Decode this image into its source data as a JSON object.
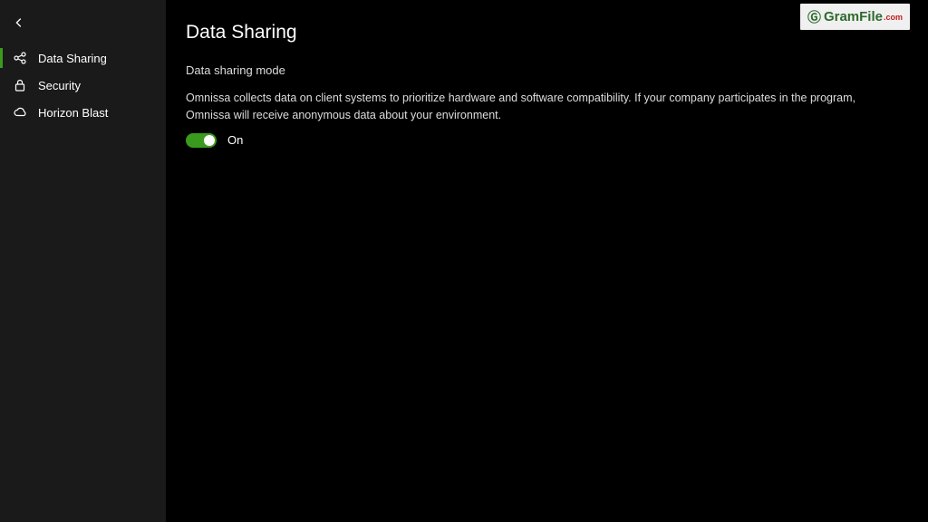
{
  "sidebar": {
    "items": [
      {
        "label": "Data Sharing",
        "icon": "share-icon",
        "active": true
      },
      {
        "label": "Security",
        "icon": "lock-icon",
        "active": false
      },
      {
        "label": "Horizon Blast",
        "icon": "cloud-icon",
        "active": false
      }
    ]
  },
  "main": {
    "title": "Data Sharing",
    "section_label": "Data sharing mode",
    "description": "Omnissa collects data on client systems to prioritize hardware and software compatibility. If your company participates in the program, Omnissa will receive anonymous data about your environment.",
    "toggle": {
      "state": "on",
      "label": "On"
    }
  },
  "watermark": {
    "brand_main": "GramFile",
    "brand_suffix": ".com"
  },
  "colors": {
    "accent": "#3a9a1e",
    "sidebar_bg": "#1a1a1a",
    "main_bg": "#000000"
  }
}
